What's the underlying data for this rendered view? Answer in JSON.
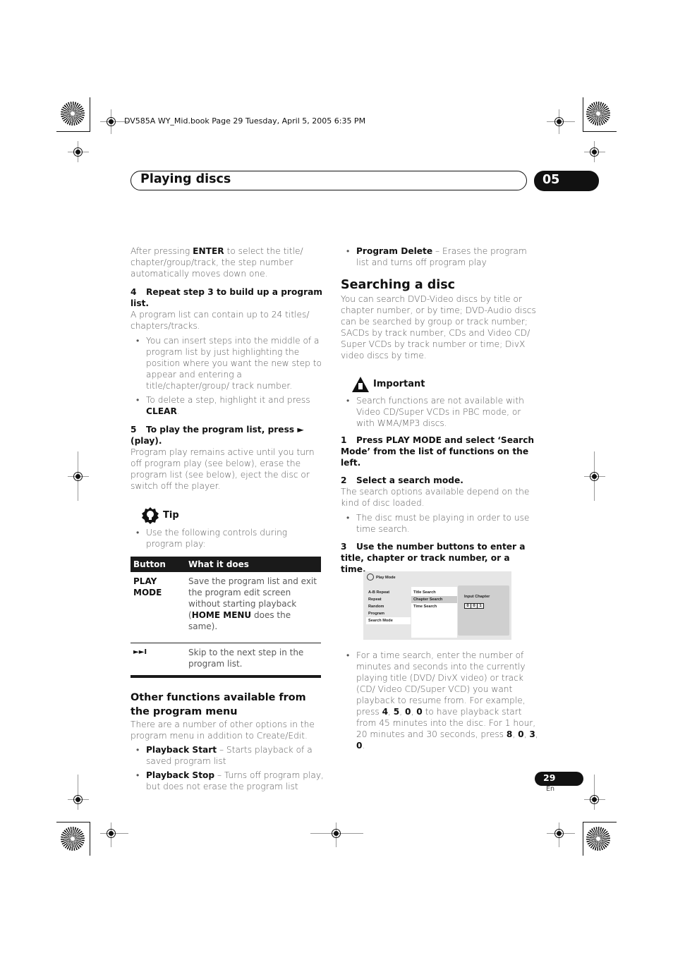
{
  "slug": "DV585A WY_Mid.book  Page 29  Tuesday, April 5, 2005  6:35 PM",
  "header": {
    "title": "Playing discs",
    "chapter": "05"
  },
  "footer": {
    "page": "29",
    "lang": "En"
  },
  "left": {
    "intro": {
      "pre": "After pressing ",
      "bold": "ENTER",
      "post": " to select the title/ chapter/group/track, the step number automatically moves down one."
    },
    "step4": {
      "num": "4",
      "title": "Repeat step 3 to build up a program list.",
      "text": "A program list can contain up to 24 titles/ chapters/tracks."
    },
    "step4_bullets": [
      {
        "text": "You can insert steps into the middle of a program list by just highlighting the position where you want the new step to appear and entering a title/chapter/group/ track number."
      },
      {
        "pre": "To delete a step, highlight it and press ",
        "bold": "CLEAR",
        "post": "."
      }
    ],
    "step5": {
      "num": "5",
      "title": "To play the program list, press ► (play).",
      "text": "Program play remains active until you turn off program play (see below), erase the program list (see below), eject the disc or switch off the player."
    },
    "tip": {
      "label": "Tip",
      "icon": "lightbulb-icon",
      "bullet": "Use the following controls during program play:"
    },
    "table": {
      "headers": [
        "Button",
        "What it does"
      ],
      "rows": [
        {
          "button": "PLAY MODE",
          "pre": "Save the program list and exit the program edit screen without starting playback (",
          "bold": "HOME MENU",
          "post": " does the same)."
        },
        {
          "button": "►►I",
          "pre": "Skip to the next step in the program list.",
          "bold": "",
          "post": ""
        }
      ]
    },
    "other": {
      "heading": "Other functions available from the program menu",
      "text": "There are a number of other options in the program menu in addition to Create/Edit.",
      "bullets": [
        {
          "bold": "Playback Start",
          "text": " – Starts playback of a saved program list"
        },
        {
          "bold": "Playback Stop",
          "text": " – Turns off program play, but does not erase the program list"
        }
      ]
    }
  },
  "right": {
    "top_bullet": {
      "bold": "Program Delete",
      "text": " – Erases the program list and turns off program play"
    },
    "heading": "Searching a disc",
    "intro": "You can search DVD-Video discs by title or chapter number, or by time; DVD-Audio discs can be searched by group or track number; SACDs by track number, CDs and Video CD/ Super VCDs by track number or time; DivX video discs by time.",
    "important": {
      "label": "Important",
      "icon": "warning-hand-icon",
      "bullet": "Search functions are not available with Video CD/Super VCDs in PBC mode, or with WMA/MP3 discs."
    },
    "step1": {
      "num": "1",
      "title": "Press PLAY MODE and select ‘Search Mode’ from the list of functions on the left."
    },
    "step2": {
      "num": "2",
      "title": "Select a search mode.",
      "text": "The search options available depend on the kind of disc loaded."
    },
    "step2_bullet": "The disc must be playing in order to use time search.",
    "step3": {
      "num": "3",
      "title": "Use the number buttons to enter a title, chapter or track number, or a time."
    },
    "osd": {
      "title": "Play Mode",
      "menu": [
        "A-B Repeat",
        "Repeat",
        "Random",
        "Program",
        "Search Mode"
      ],
      "selected_menu": "Search Mode",
      "submenu": [
        "Title Search",
        "Chapter Search",
        "Time Search"
      ],
      "selected_submenu": "Chapter Search",
      "input_label": "Input Chapter",
      "digits": [
        "0",
        "0",
        "1"
      ]
    },
    "final_bullet": {
      "t1": "For a time search, enter the number of minutes and seconds into the currently playing title (DVD/ DivX video) or track (CD/ Video CD/Super VCD) you want playback to resume from. For example, press ",
      "k1": "4",
      "s1": ", ",
      "k2": "5",
      "s2": ", ",
      "k3": "0",
      "s3": ", ",
      "k4": "0",
      "t2": " to have playback start from 45 minutes into the disc. For 1 hour, 20 minutes and 30 seconds, press ",
      "k5": "8",
      "s5": ", ",
      "k6": "0",
      "s6": ", ",
      "k7": "3",
      "s7": ", ",
      "k8": "0",
      "t3": "."
    }
  }
}
